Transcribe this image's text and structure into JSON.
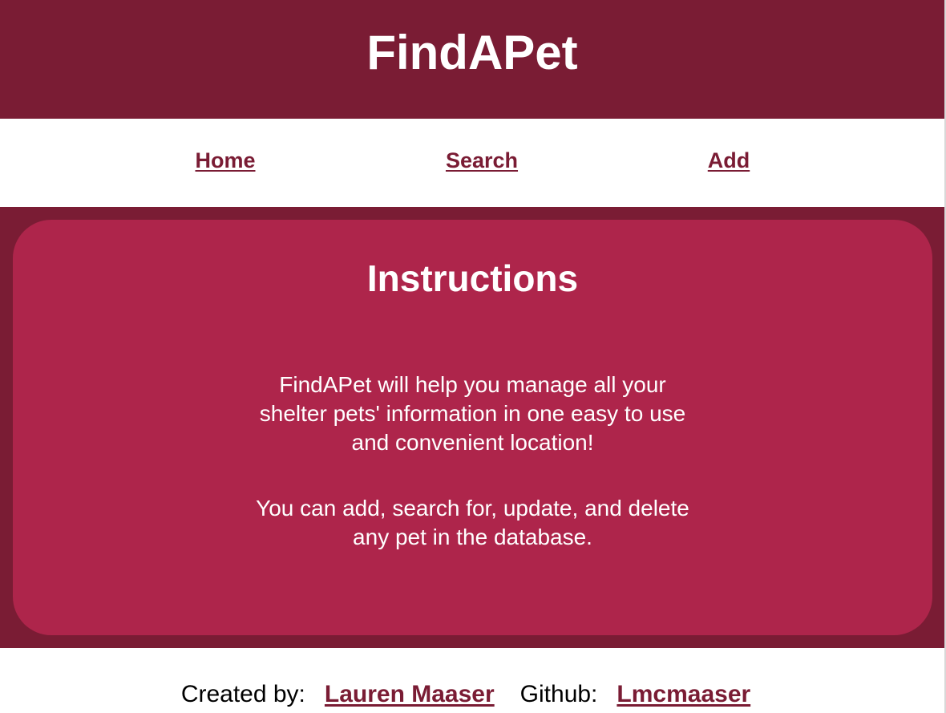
{
  "header": {
    "title": "FindAPet"
  },
  "nav": {
    "items": [
      {
        "label": "Home"
      },
      {
        "label": "Search"
      },
      {
        "label": "Add"
      }
    ]
  },
  "instructions": {
    "heading": "Instructions",
    "paragraphs": [
      "FindAPet will help you manage all your shelter pets' information in one easy to use and convenient location!",
      "You can add, search for, update, and delete any pet in the database."
    ]
  },
  "footer": {
    "created_label": "Created by:",
    "author": "Lauren Maaser",
    "github_label": "Github:",
    "github_user": "Lmcmaaser"
  },
  "colors": {
    "header_bg": "#7a1c34",
    "card_bg": "#ae254b",
    "link": "#7a1c34",
    "text_light": "#ffffff"
  }
}
